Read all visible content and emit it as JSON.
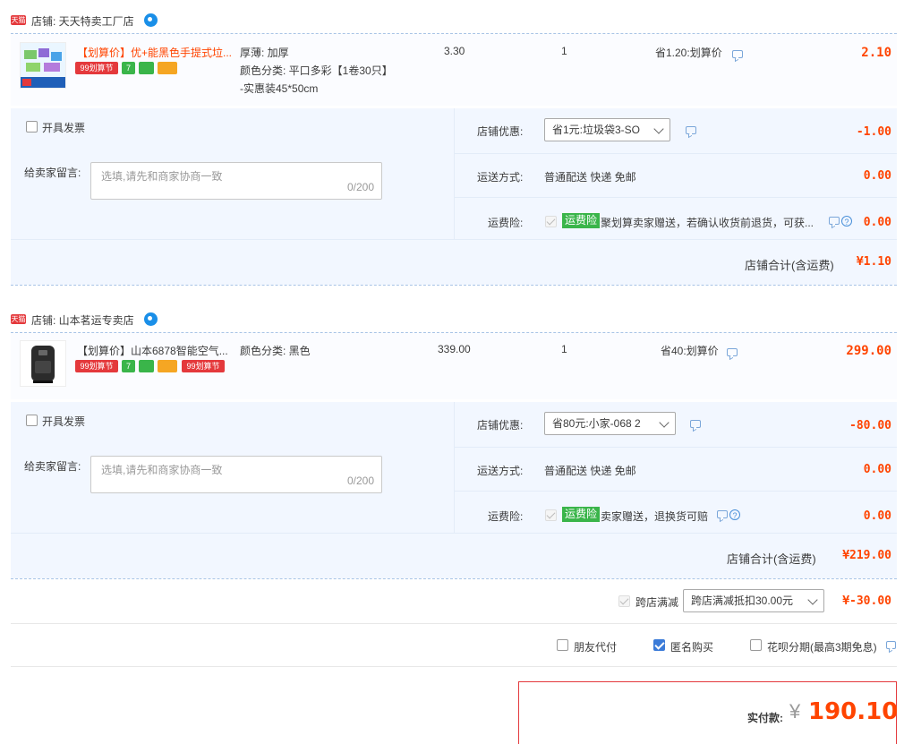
{
  "colors": {
    "accent_red": "#ff4400",
    "link_blue": "#3b7bd8",
    "option_bg": "#f2f7ff",
    "green_badge": "#3ab54a"
  },
  "tmall_badge": "天猫",
  "shops": [
    {
      "shop_label": "店铺: 天天特卖工厂店",
      "item": {
        "title": "【划算价】优+能黑色手提式垃...",
        "sku_lines": [
          "厚薄: 加厚",
          "颜色分类: 平口多彩【1卷30只】",
          "-实惠装45*50cm"
        ],
        "unit_price": "3.30",
        "quantity": "1",
        "discount": "省1.20:划算价",
        "subtotal": "2.10",
        "tags": [
          {
            "text": "99划算节",
            "color": "#e4393c",
            "icon": "sale-tag-icon"
          },
          {
            "text": "7",
            "color": "#3ab54a",
            "icon": "seven-day-return-icon"
          },
          {
            "text": "",
            "color": "#3ab54a",
            "icon": "service-icon"
          },
          {
            "text": "",
            "color": "#f5a623",
            "icon": "card-icon"
          }
        ]
      },
      "invoice_label": "开具发票",
      "message_label": "给卖家留言:",
      "message_placeholder": "选填,请先和商家协商一致",
      "message_count": "0/200",
      "coupon_label": "店铺优惠:",
      "coupon_value": "省1元:垃圾袋3-SO",
      "coupon_amount": "-1.00",
      "shipping_label": "运送方式:",
      "shipping_value": "普通配送 快递 免邮",
      "shipping_amount": "0.00",
      "insurance_label": "运费险:",
      "insurance_badge": "运费险",
      "insurance_text": "聚划算卖家赠送，若确认收货前退货，可获...",
      "insurance_amount": "0.00",
      "total_label": "店铺合计(含运费)",
      "total_amount": "¥1.10"
    },
    {
      "shop_label": "店铺: 山本茗运专卖店",
      "item": {
        "title": "【划算价】山本6878智能空气...",
        "sku_lines": [
          "颜色分类: 黑色"
        ],
        "unit_price": "339.00",
        "quantity": "1",
        "discount": "省40:划算价",
        "subtotal": "299.00",
        "tags": [
          {
            "text": "99划算节",
            "color": "#e4393c",
            "icon": "sale-tag-icon"
          },
          {
            "text": "7",
            "color": "#3ab54a",
            "icon": "seven-day-return-icon"
          },
          {
            "text": "",
            "color": "#3ab54a",
            "icon": "service-icon"
          },
          {
            "text": "",
            "color": "#f5a623",
            "icon": "card-icon"
          },
          {
            "text": "99划算节",
            "color": "#e4393c",
            "icon": "sale-tag-icon"
          }
        ]
      },
      "invoice_label": "开具发票",
      "message_label": "给卖家留言:",
      "message_placeholder": "选填,请先和商家协商一致",
      "message_count": "0/200",
      "coupon_label": "店铺优惠:",
      "coupon_value": "省80元:小家-068 2",
      "coupon_amount": "-80.00",
      "shipping_label": "运送方式:",
      "shipping_value": "普通配送 快递 免邮",
      "shipping_amount": "0.00",
      "insurance_label": "运费险:",
      "insurance_badge": "运费险",
      "insurance_text": "卖家赠送，退换货可赔",
      "insurance_amount": "0.00",
      "total_label": "店铺合计(含运费)",
      "total_amount": "¥219.00"
    }
  ],
  "cross_store": {
    "label": "跨店满减",
    "select_value": "跨店满减抵扣30.00元",
    "amount": "¥-30.00"
  },
  "options": {
    "friend_pay": "朋友代付",
    "anonymous": "匿名购买",
    "installment": "花呗分期(最高3期免息)"
  },
  "payment": {
    "label": "实付款:",
    "currency": "¥",
    "amount": "190.10"
  }
}
